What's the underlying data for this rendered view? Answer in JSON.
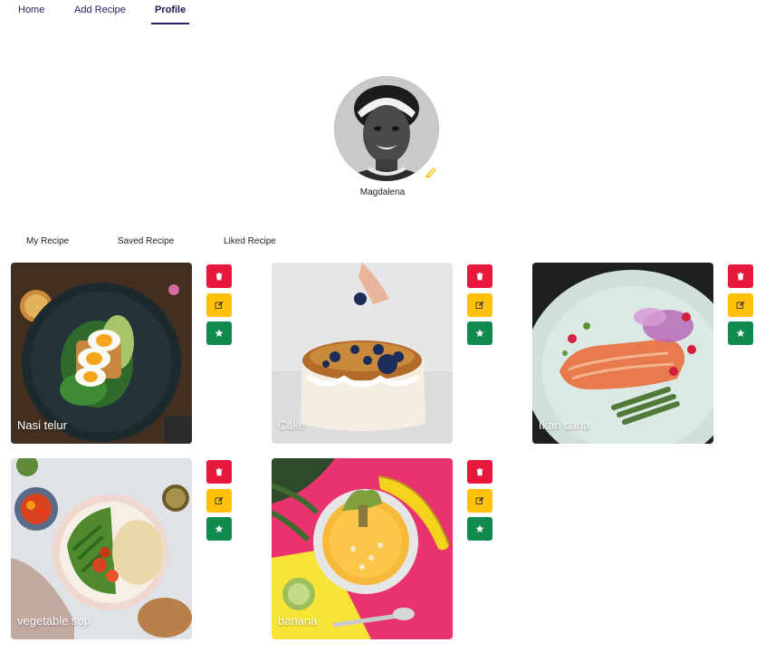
{
  "nav": {
    "home": "Home",
    "add_recipe": "Add Recipe",
    "profile": "Profile"
  },
  "profile": {
    "name": "Magdalena"
  },
  "tabs": {
    "my_recipe": "My Recipe",
    "saved_recipe": "Saved Recipe",
    "liked_recipe": "Liked Recipe"
  },
  "recipes": [
    {
      "title": "Nasi telur"
    },
    {
      "title": "Cake"
    },
    {
      "title": "Ikan cana"
    },
    {
      "title": "vegetable sop"
    },
    {
      "title": "banana"
    }
  ],
  "colors": {
    "accent": "#2a1d63",
    "delete": "#e8173c",
    "edit": "#ffc107",
    "favorite": "#108a4f"
  },
  "icons": {
    "delete": "trash-icon",
    "edit": "edit-icon",
    "favorite": "star-icon",
    "avatar_edit": "pencil-icon"
  }
}
